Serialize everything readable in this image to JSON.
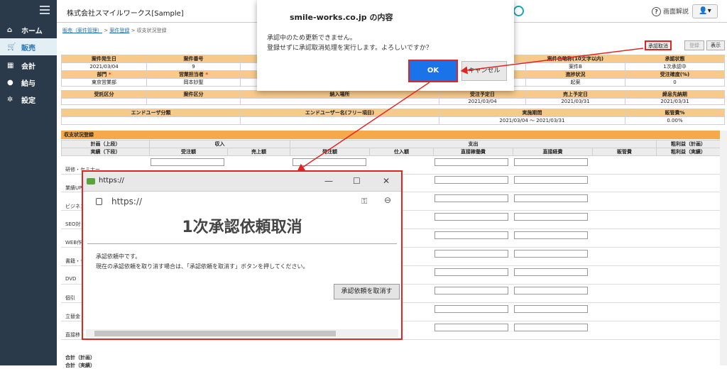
{
  "sidebar": {
    "items": [
      {
        "label": "ホーム",
        "icon": "home-icon"
      },
      {
        "label": "販売",
        "icon": "cart-icon"
      },
      {
        "label": "会計",
        "icon": "calculator-icon"
      },
      {
        "label": "給与",
        "icon": "money-bag-icon"
      },
      {
        "label": "設定",
        "icon": "gear-icon"
      }
    ]
  },
  "header": {
    "company": "株式会社スマイルワークス[Sample]",
    "help": "画面解説",
    "user_icon": "user-icon"
  },
  "breadcrumb": {
    "item1": "販売（案件管理）",
    "sep": ">",
    "item2": "案件登録",
    "item3": "> 収支状況登録"
  },
  "toolbar": {
    "cancel_approval": "承認取消",
    "register": "登録",
    "display": "表示"
  },
  "summary": {
    "row1_headers": [
      "案件発生日",
      "案件番号",
      "",
      "案件名略称(10文字以内)",
      "承認状態"
    ],
    "row1_values": [
      "2021/03/04",
      "9",
      "",
      "案件B",
      "1次承認中"
    ],
    "row2_headers": [
      "部門",
      "営業担当者",
      "",
      "進捗状況",
      "受注確度(%)"
    ],
    "row2_values": [
      "東京営業部",
      "岡本妙聖",
      "",
      "起案",
      "0"
    ],
    "row3_headers": [
      "受託区分",
      "案件区分",
      "納入場所",
      "受注予定日",
      "売上予定日",
      "締息先納期"
    ],
    "row3_values": [
      "",
      "",
      "",
      "2021/03/04",
      "2021/03/31",
      "2021/03/31"
    ],
    "row4_headers": [
      "エンドユーザ分類",
      "エンドユーザー名(フリー項目)",
      "実施期間",
      "販管費%"
    ],
    "row4_values": [
      "",
      "",
      "2021/03/04 〜 2021/03/31",
      "0.00%"
    ],
    "required_mark": "*"
  },
  "income": {
    "section_title": "収支状況登録",
    "hdr1": [
      "計画（上段）",
      "収入",
      "支出",
      "粗利益（計画）"
    ],
    "hdr2": [
      "実績（下段）",
      "受注額",
      "売上額",
      "発注額",
      "仕入額",
      "直接稼働費",
      "直接経費",
      "販管費",
      "粗利益（実績）"
    ],
    "rows": [
      "研修・セミナー",
      "業績UP",
      "ビジネス",
      "SEO対",
      "WEB作",
      "書籍・デ",
      "DVD",
      "個引",
      "立替金",
      "直接移"
    ],
    "totals": [
      "合計（計画）",
      "合計（実績）"
    ]
  },
  "dialog": {
    "title": "smile-works.co.jp の内容",
    "msg1": "承認中のため更新できません。",
    "msg2": "登録せずに承認取消処理を実行します。よろしいですか？",
    "ok": "OK",
    "cancel": "キャンセル"
  },
  "popup": {
    "title": "https://",
    "url": "https://",
    "heading": "1次承認依頼取消",
    "msg1": "承認依頼中です。",
    "msg2": "現在の承認依頼を取り消す場合は、「承認依頼を取消す」ボタンを押してください。",
    "button": "承認依頼を取消す",
    "minimize": "—",
    "maximize": "☐",
    "close": "✕",
    "key": "⚿",
    "zoom": "⊖"
  },
  "colors": {
    "sidebar": "#2b3a4a",
    "accent": "#1a73e8",
    "header_orange": "#f7c98a",
    "section_orange": "#f5a94a",
    "annotation_red": "#e02424"
  }
}
